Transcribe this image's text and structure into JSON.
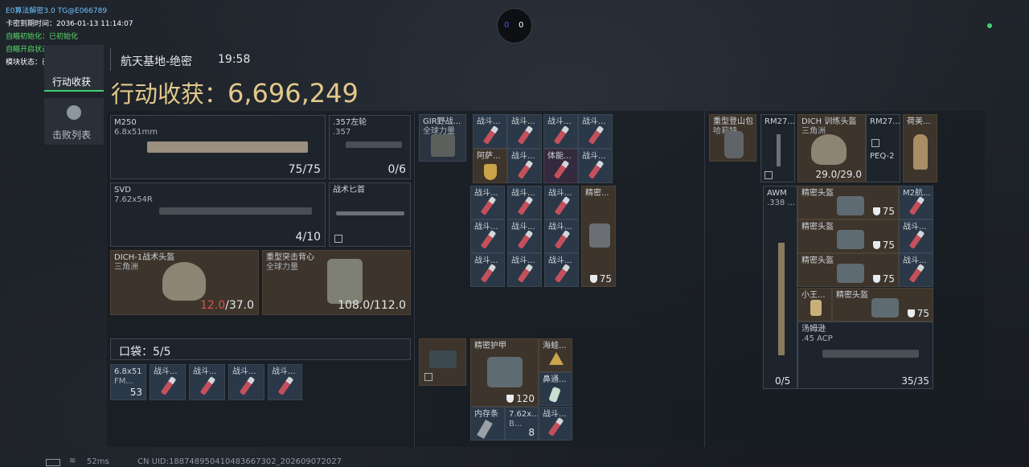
{
  "overlay": {
    "line1": "E0算法解密3.0 TG@E066789",
    "line2": "卡密到期时间：2036-01-13 11:14:07",
    "line3": "自瞄初始化：已初始化",
    "line4": "自瞄开启状态：未开启",
    "line5": "模块状态：已加载"
  },
  "nav": {
    "tab1": "行动收获",
    "tab2": "击败列表"
  },
  "header": {
    "map": "航天基地-绝密",
    "time": "19:58",
    "title_label": "行动收获：",
    "value": "6,696,249"
  },
  "top_indicator": {
    "left": "0",
    "right": "0"
  },
  "weapons": {
    "primary": {
      "name": "M250",
      "ammo": "6.8x51mm",
      "count": "75/75"
    },
    "pistol": {
      "name": ".357左轮",
      "ammo": ".357",
      "count": "0/6"
    },
    "secondary": {
      "name": "SVD",
      "ammo": "7.62x54R",
      "count": "4/10"
    },
    "melee": {
      "name": "战术匕首"
    },
    "helmet": {
      "name": "DICH-1战术头盔",
      "sub": "三角洲",
      "cur": "12.0",
      "max": "/37.0"
    },
    "armor": {
      "name": "重型突击背心",
      "sub": "全球力量",
      "value": "108.0/112.0"
    }
  },
  "pouch": {
    "label": "口袋：",
    "value": "5/5",
    "ammo_name": "6.8x51",
    "ammo_sub": "FM...",
    "ammo_count": "53",
    "item": "战斗..."
  },
  "middle": {
    "rig": {
      "name": "GIR野战...",
      "sub": "全球力量"
    },
    "stim": "战斗...",
    "trophy": "阿萨...",
    "tizhi": "体能...",
    "jingmi": "精密...",
    "jingmi_val": "75",
    "case_armor": "精密护甲",
    "case_armor_val": "120",
    "sea": "海蛙...",
    "tong": "鼻通...",
    "neicun": "内存条",
    "ammo762": "7.62x...",
    "ammo762_sub": "B...",
    "ammo762_count": "8"
  },
  "right": {
    "bag": {
      "name": "重型登山包",
      "sub": "哈莉特"
    },
    "rm1": "RM27...",
    "helm": {
      "name": "DICH 训练头盔",
      "sub": "三角洲",
      "value": "29.0/29.0"
    },
    "rm2": "RM27...",
    "peq": "PEQ-2",
    "hemei": "荷美...",
    "awm": {
      "name": "AWM",
      "ammo": ".338 ...",
      "count": "0/5"
    },
    "jingmi": "精密头盔",
    "jingmi_val": "75",
    "m2": "M2航...",
    "zhandou": "战斗...",
    "xiaowang": "小王...",
    "thompson": {
      "name": "汤姆逊",
      "ammo": ".45 ACP",
      "count": "35/35"
    }
  },
  "footer": {
    "ping": "52ms",
    "uid": "CN UID:18874895041048366730​2_202609072027"
  },
  "colors": {
    "gold": "#e3c98a",
    "red": "#d9524a",
    "green": "#3fd06f"
  }
}
